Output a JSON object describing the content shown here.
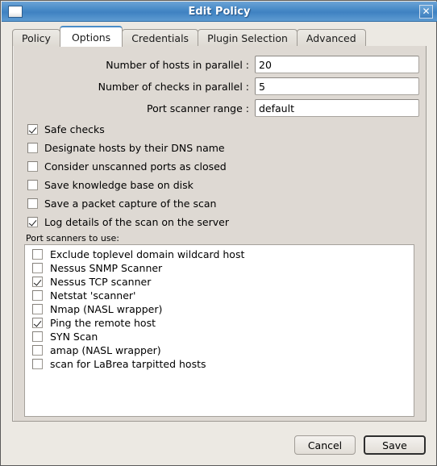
{
  "window": {
    "title": "Edit Policy",
    "icon": "window-icon",
    "close_label": "✕"
  },
  "tabs": [
    {
      "label": "Policy",
      "active": false
    },
    {
      "label": "Options",
      "active": true
    },
    {
      "label": "Credentials",
      "active": false
    },
    {
      "label": "Plugin Selection",
      "active": false
    },
    {
      "label": "Advanced",
      "active": false
    }
  ],
  "fields": [
    {
      "label": "Number of hosts in parallel :",
      "value": "20",
      "placeholder": ""
    },
    {
      "label": "Number of checks in parallel :",
      "value": "5",
      "placeholder": ""
    },
    {
      "label": "Port scanner range :",
      "value": "default",
      "placeholder": ""
    }
  ],
  "options": [
    {
      "label": "Safe checks",
      "checked": true
    },
    {
      "label": "Designate hosts by their DNS name",
      "checked": false
    },
    {
      "label": "Consider unscanned ports as closed",
      "checked": false
    },
    {
      "label": "Save knowledge base on disk",
      "checked": false
    },
    {
      "label": "Save a packet capture of the scan",
      "checked": false
    },
    {
      "label": "Log details of the scan on the server",
      "checked": true
    }
  ],
  "port_scanners": {
    "group_label": "Port scanners to use:",
    "items": [
      {
        "label": "Exclude toplevel domain wildcard host",
        "checked": false
      },
      {
        "label": "Nessus SNMP Scanner",
        "checked": false
      },
      {
        "label": "Nessus TCP scanner",
        "checked": true
      },
      {
        "label": "Netstat 'scanner'",
        "checked": false
      },
      {
        "label": "Nmap (NASL wrapper)",
        "checked": false
      },
      {
        "label": "Ping the remote host",
        "checked": true
      },
      {
        "label": "SYN Scan",
        "checked": false
      },
      {
        "label": "amap (NASL wrapper)",
        "checked": false
      },
      {
        "label": "scan for LaBrea tarpitted hosts",
        "checked": false
      }
    ]
  },
  "footer": {
    "cancel_label": "Cancel",
    "save_label": "Save"
  },
  "colors": {
    "titlebar_blue": "#4a8cc8",
    "panel_bg": "#ded9d3",
    "window_bg": "#ece9e3",
    "field_bg": "#ffffff",
    "border": "#9e9a94"
  }
}
